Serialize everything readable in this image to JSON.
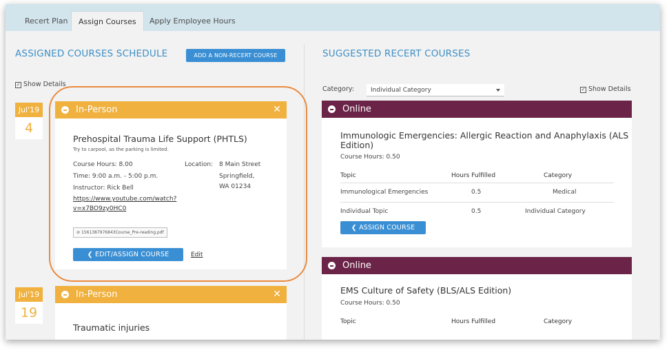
{
  "tabs": [
    "Recert Plan",
    "Assign Courses",
    "Apply Employee Hours"
  ],
  "left": {
    "title": "ASSIGNED COURSES SCHEDULE",
    "add_button": "ADD A NON-RECERT COURSE",
    "show_details": "Show Details",
    "courses": [
      {
        "month": "Jul'19",
        "day": "4",
        "type": "In-Person",
        "title": "Prehospital Trauma Life Support (PHTLS)",
        "note": "Try to carpool, as the parking is limited.",
        "hours": "Course Hours: 8.00",
        "time": "Time: 9:00 a.m. - 5:00 p.m.",
        "instructor": "Instructor: Rick Bell",
        "link_line1": "https://www.youtube.com/watch?",
        "link_line2": "v=x7BO9zy0HC0",
        "location_label": "Location:",
        "location_line1": "8 Main Street",
        "location_line2": "Springfield,",
        "location_line3": "WA 01234",
        "file": "1561387976843Course_Pre-reading.pdf",
        "edit_assign_button": "EDIT/ASSIGN COURSE",
        "edit_link": "Edit"
      },
      {
        "month": "Jul'19",
        "day": "19",
        "type": "In-Person",
        "title": "Traumatic injuries"
      }
    ]
  },
  "right": {
    "title": "SUGGESTED RECERT COURSES",
    "category_label": "Category:",
    "category_value": "Individual Category",
    "show_details": "Show Details",
    "courses": [
      {
        "type": "Online",
        "title_line1": "Immunologic Emergencies: Allergic Reaction and Anaphylaxis (ALS",
        "title_line2": "Edition)",
        "hours": "Course Hours: 0.50",
        "col_topic": "Topic",
        "col_hours": "Hours Fulfilled",
        "col_category": "Category",
        "rows": [
          {
            "topic": "Immunological Emergencies",
            "hours": "0.5",
            "category": "Medical"
          },
          {
            "topic": "Individual Topic",
            "hours": "0.5",
            "category": "Individual Category"
          }
        ],
        "assign_button": "ASSIGN COURSE"
      },
      {
        "type": "Online",
        "title": "EMS Culture of Safety (BLS/ALS Edition)",
        "hours": "Course Hours: 0.50",
        "col_topic": "Topic",
        "col_hours": "Hours Fulfilled",
        "col_category": "Category"
      }
    ]
  },
  "colors": {
    "accent_blue": "#3a8fd4",
    "in_person": "#f0b13f",
    "online": "#6b2447",
    "highlight": "#ea8a3d"
  }
}
